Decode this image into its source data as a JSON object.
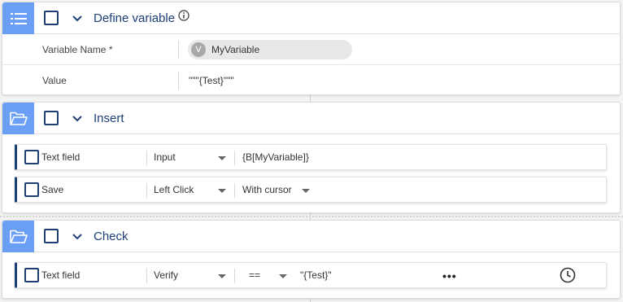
{
  "define_block": {
    "title": "Define variable",
    "icon": "list-icon",
    "properties": {
      "name_label": "Variable Name *",
      "variable_chip_letter": "V",
      "variable_name": "MyVariable",
      "value_label": "Value",
      "value": "\"\"\"{Test}\"\"\""
    }
  },
  "insert_block": {
    "title": "Insert",
    "icon": "folder-open-icon",
    "steps": [
      {
        "target": "Text field",
        "action": "Input",
        "value": "{B[MyVariable]}"
      },
      {
        "target": "Save",
        "action": "Left Click",
        "option": "With cursor"
      }
    ]
  },
  "check_block": {
    "title": "Check",
    "icon": "folder-open-icon",
    "step": {
      "target": "Text field",
      "action": "Verify",
      "operator": "==",
      "expected": "\"{Test}\"",
      "more": "•••"
    }
  },
  "colors": {
    "accent": "#6a9ff5",
    "title": "#1d3f77"
  }
}
